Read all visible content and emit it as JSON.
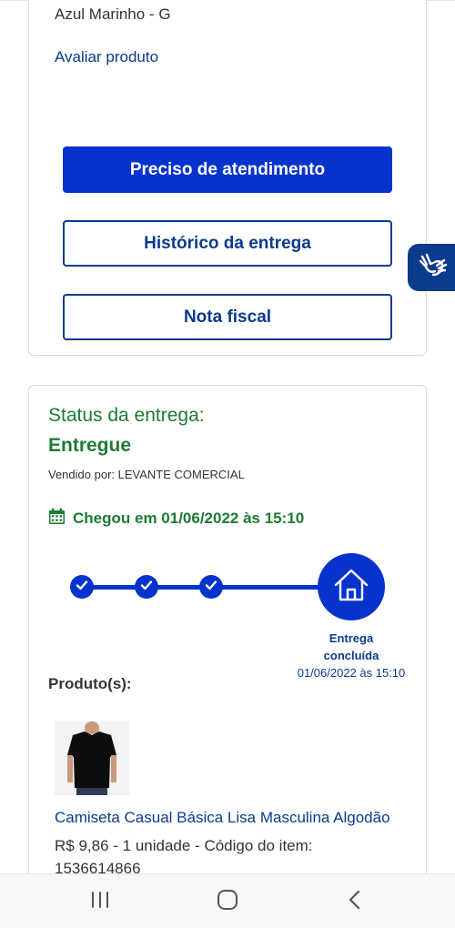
{
  "order_card": {
    "variant": "Azul Marinho - G",
    "rate_link": "Avaliar produto",
    "btn_support": "Preciso de atendimento",
    "btn_history": "Histórico da entrega",
    "btn_invoice": "Nota fiscal"
  },
  "delivery": {
    "status_label": "Status da entrega:",
    "status_value": "Entregue",
    "seller": "Vendido por: LEVANTE COMERCIAL",
    "arrived": "Chegou em 01/06/2022 às 15:10",
    "final_step_title_1": "Entrega",
    "final_step_title_2": "concluída",
    "final_step_date": "01/06/2022 às 15:10",
    "steps_completed": 4,
    "steps_total": 4
  },
  "products": {
    "title": "Produto(s):",
    "items": [
      {
        "name": "Camiseta Casual Básica Lisa Masculina Algodão",
        "info": "R$ 9,86 - 1 unidade - Código do item: 1536614866"
      }
    ]
  },
  "colors": {
    "primary": "#0633cc",
    "navy": "#0a3b8c",
    "success": "#1e7b34"
  },
  "icons": {
    "accessibility": "sign-language-hands-icon",
    "calendar": "calendar-icon",
    "check": "check-icon",
    "home": "house-icon"
  },
  "system_nav": [
    "recent-apps",
    "home",
    "back"
  ]
}
